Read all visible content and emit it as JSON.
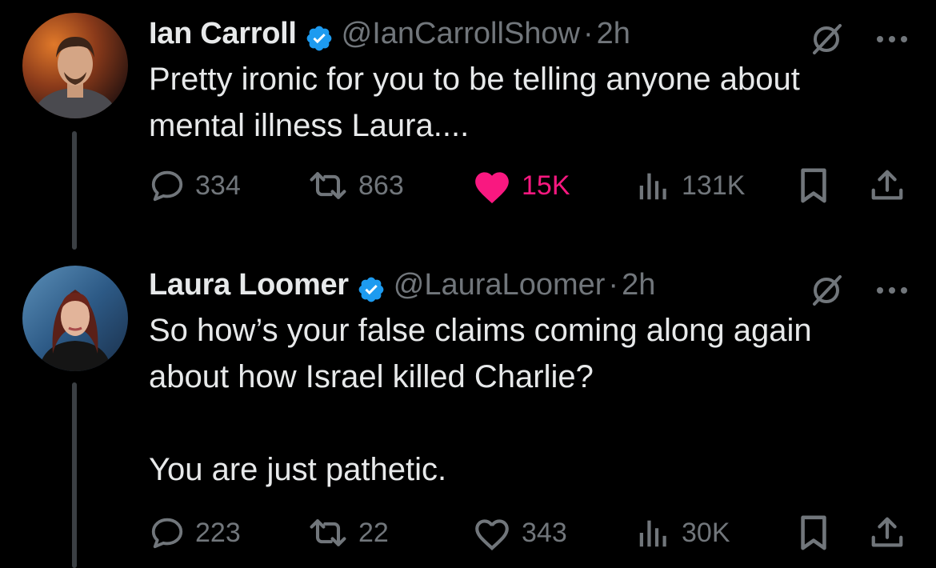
{
  "tweets": [
    {
      "author_name": "Ian Carroll",
      "verified": true,
      "handle": "@IanCarrollShow",
      "separator": "·",
      "time": "2h",
      "text": "Pretty ironic for you to be telling anyone about\nmental illness Laura....",
      "replies": "334",
      "reposts": "863",
      "likes": "15K",
      "liked": true,
      "views": "131K"
    },
    {
      "author_name": "Laura Loomer",
      "verified": true,
      "handle": "@LauraLoomer",
      "separator": "·",
      "time": "2h",
      "text": "So how’s your false claims coming along again\nabout how Israel killed Charlie?\n\nYou are just pathetic.",
      "replies": "223",
      "reposts": "22",
      "likes": "343",
      "liked": false,
      "views": "30K"
    }
  ],
  "icons": {
    "verified_badge": "verified-badge-icon",
    "grok": "grok-icon",
    "more": "more-dots-icon",
    "reply": "reply-icon",
    "repost": "repost-icon",
    "like": "heart-icon",
    "views": "views-chart-icon",
    "bookmark": "bookmark-icon",
    "share": "share-icon"
  },
  "colors": {
    "background": "#000000",
    "text": "#e7e9ea",
    "muted": "#71767b",
    "verified": "#1d9bf0",
    "like_active": "#f91880",
    "thread_line": "#3b3f43"
  }
}
